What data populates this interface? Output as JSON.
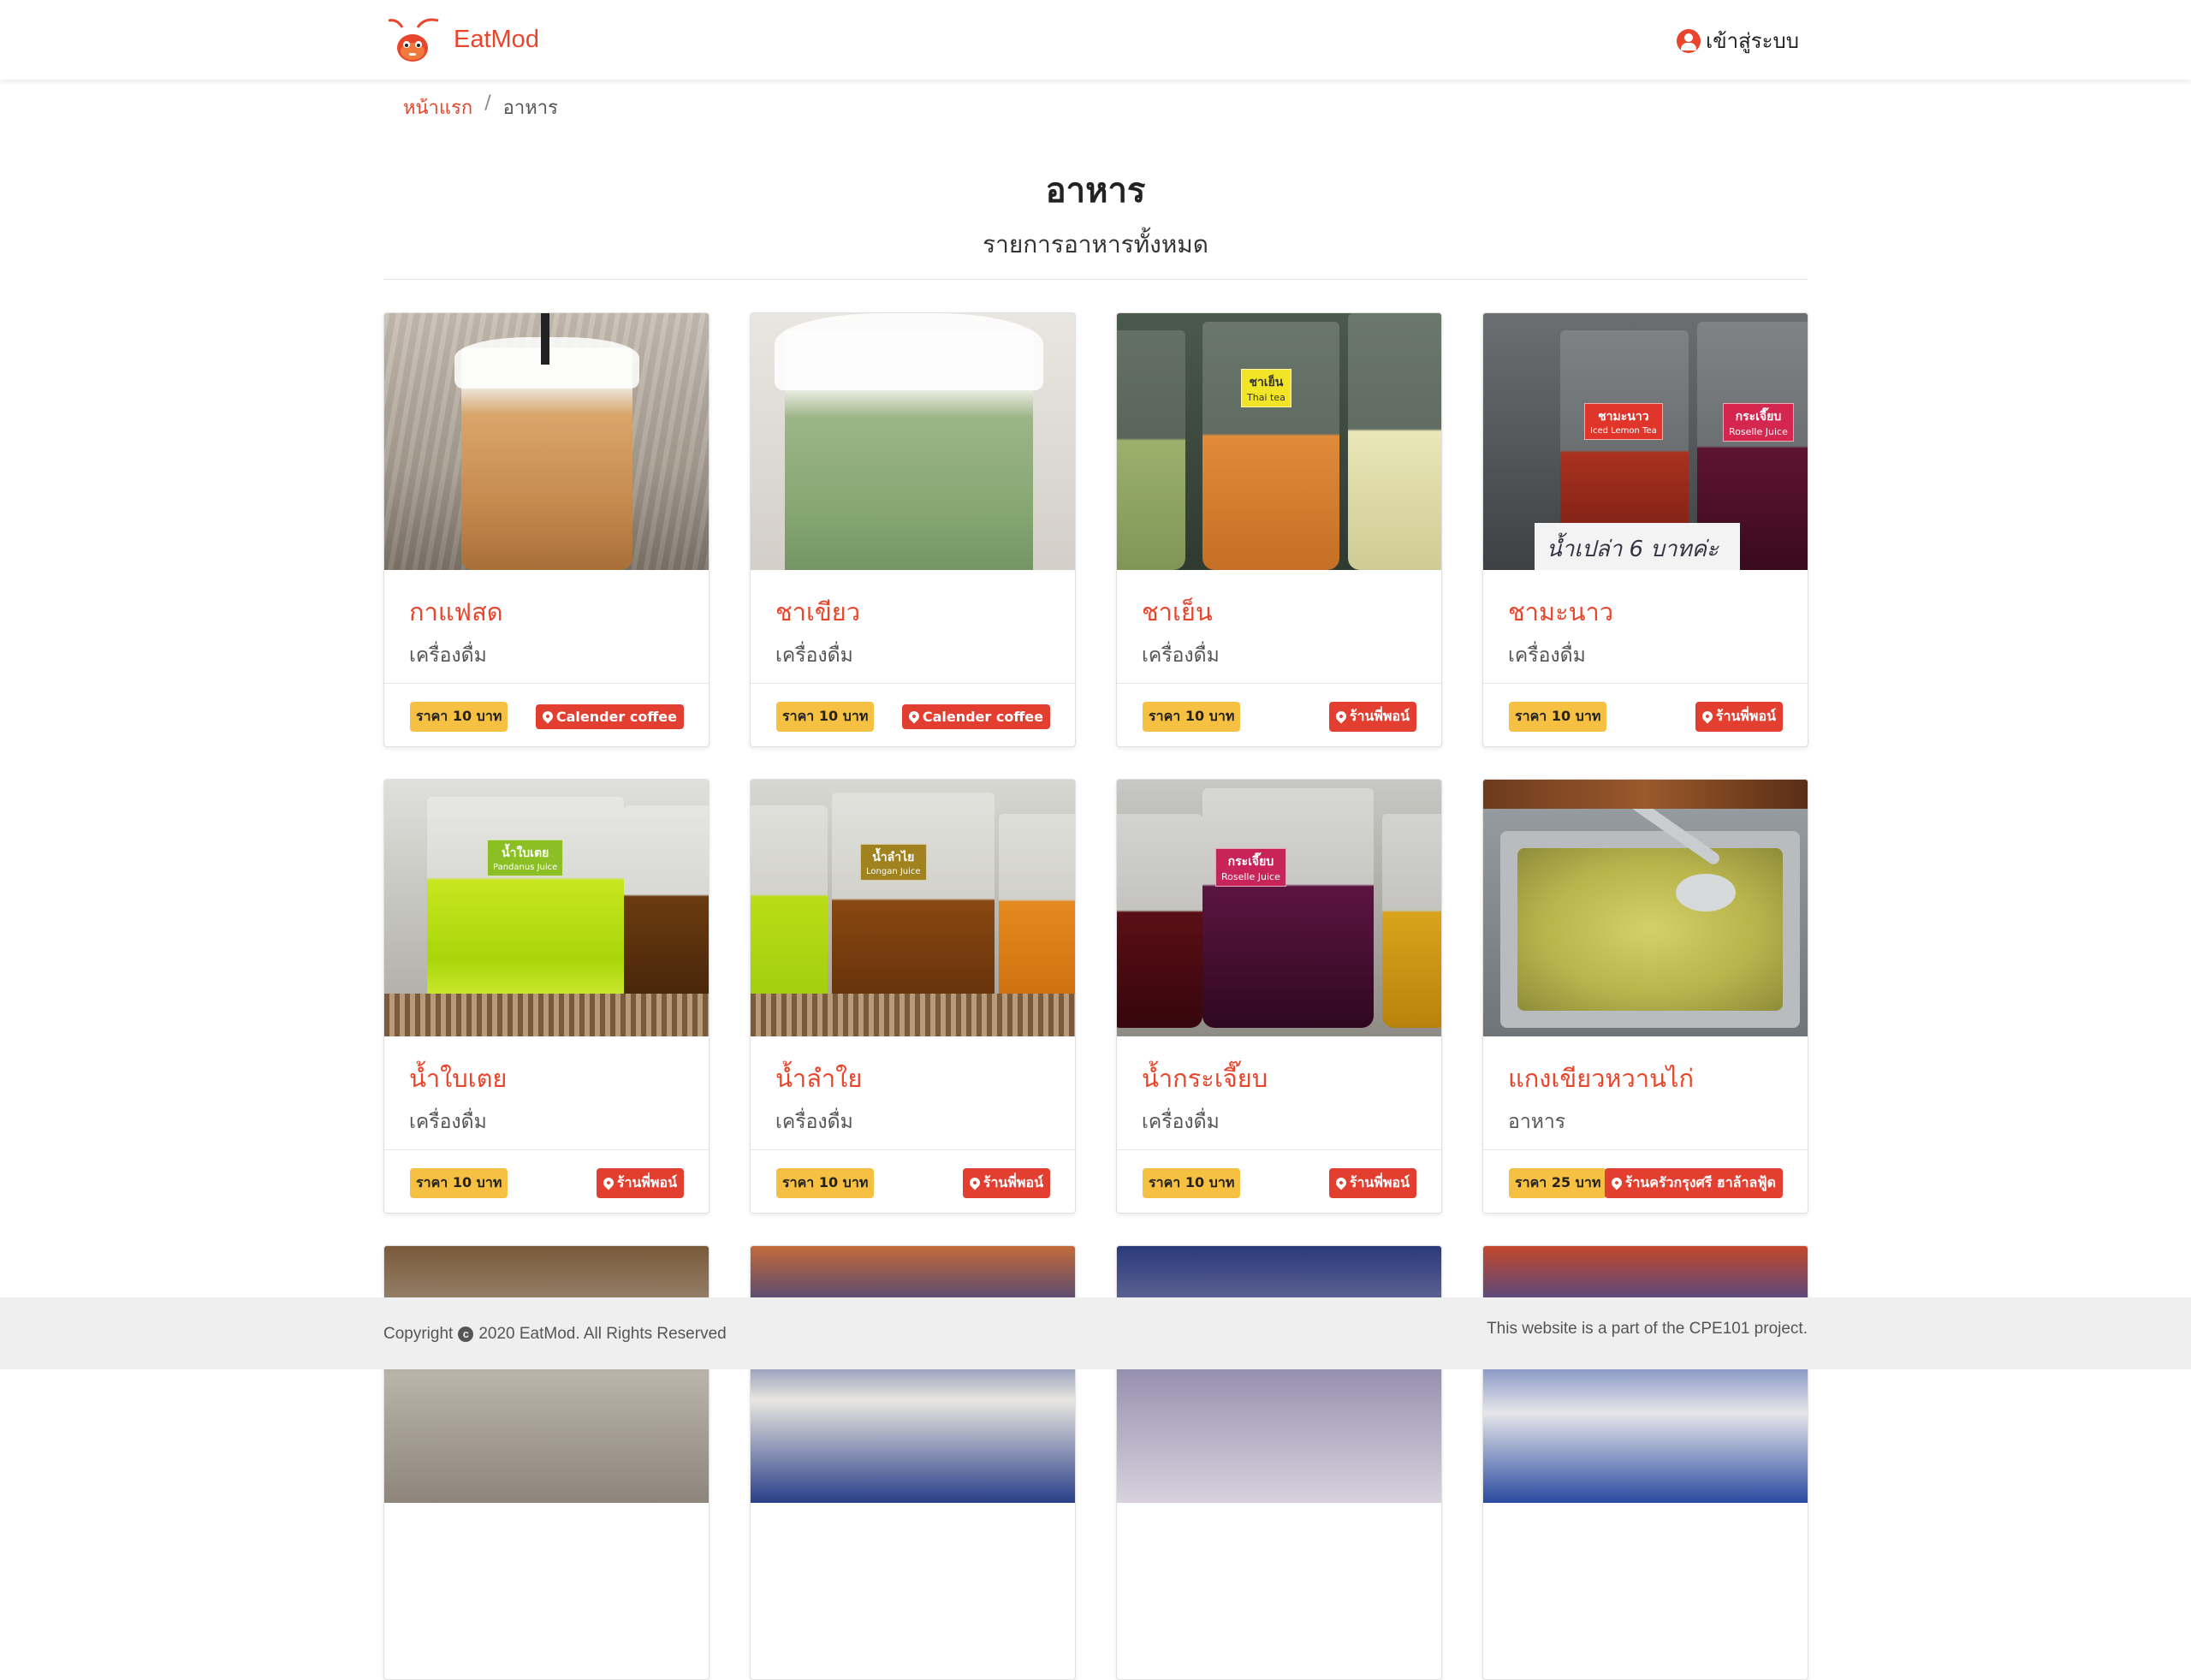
{
  "navbar": {
    "brand": "EatMod",
    "login_label": "เข้าสู่ระบบ",
    "logo_icon": "ant-mascot-icon",
    "login_icon": "user-circle-icon"
  },
  "breadcrumb": {
    "home": "หน้าแรก",
    "separator": "/",
    "current": "อาหาร"
  },
  "heading": {
    "title": "อาหาร",
    "subtitle": "รายการอาหารทั้งหมด"
  },
  "colors": {
    "accent": "#e8462c",
    "price_badge": "#f6c042",
    "shop_badge": "#e23f31",
    "footer_bg": "#efefef"
  },
  "items": [
    {
      "name": "กาแฟสด",
      "category": "เครื่องดื่ม",
      "price": "ราคา 10 บาท",
      "shop": "Calender coffee"
    },
    {
      "name": "ชาเขียว",
      "category": "เครื่องดื่ม",
      "price": "ราคา 10 บาท",
      "shop": "Calender coffee"
    },
    {
      "name": "ชาเย็น",
      "category": "เครื่องดื่ม",
      "price": "ราคา 10 บาท",
      "shop": "ร้านพี่พอน์"
    },
    {
      "name": "ชามะนาว",
      "category": "เครื่องดื่ม",
      "price": "ราคา 10 บาท",
      "shop": "ร้านพี่พอน์"
    },
    {
      "name": "น้ำใบเตย",
      "category": "เครื่องดื่ม",
      "price": "ราคา 10 บาท",
      "shop": "ร้านพี่พอน์"
    },
    {
      "name": "น้ำลำใย",
      "category": "เครื่องดื่ม",
      "price": "ราคา 10 บาท",
      "shop": "ร้านพี่พอน์"
    },
    {
      "name": "น้ำกระเจี๊ยบ",
      "category": "เครื่องดื่ม",
      "price": "ราคา 10 บาท",
      "shop": "ร้านพี่พอน์"
    },
    {
      "name": "แกงเขียวหวานไก่",
      "category": "อาหาร",
      "price": "ราคา 25 บาท",
      "shop": "ร้านครัวกรุงศรี ฮาล้าลฟู้ด"
    }
  ],
  "image_labels": {
    "thai_tea_label": "ชาเย็น",
    "thai_tea_sub": "Thai tea",
    "lemon_tea_label": "ชามะนาว",
    "lemon_tea_sub": "Iced Lemon Tea",
    "roselle_label": "กระเจี๊ยบ",
    "roselle_sub": "Roselle Juice",
    "pandan_label": "น้ำใบเตย",
    "pandan_sub": "Pandanus Juice",
    "longan_label": "น้ำลำไย",
    "longan_sub": "Longan Juice",
    "sign_text": "น้ำเปล่า 6 บาทค่ะ"
  },
  "footer": {
    "copyright_prefix": "Copyright",
    "copyright_rest": "2020 EatMod. All Rights Reserved",
    "project_note": "This website is a part of the CPE101 project."
  }
}
